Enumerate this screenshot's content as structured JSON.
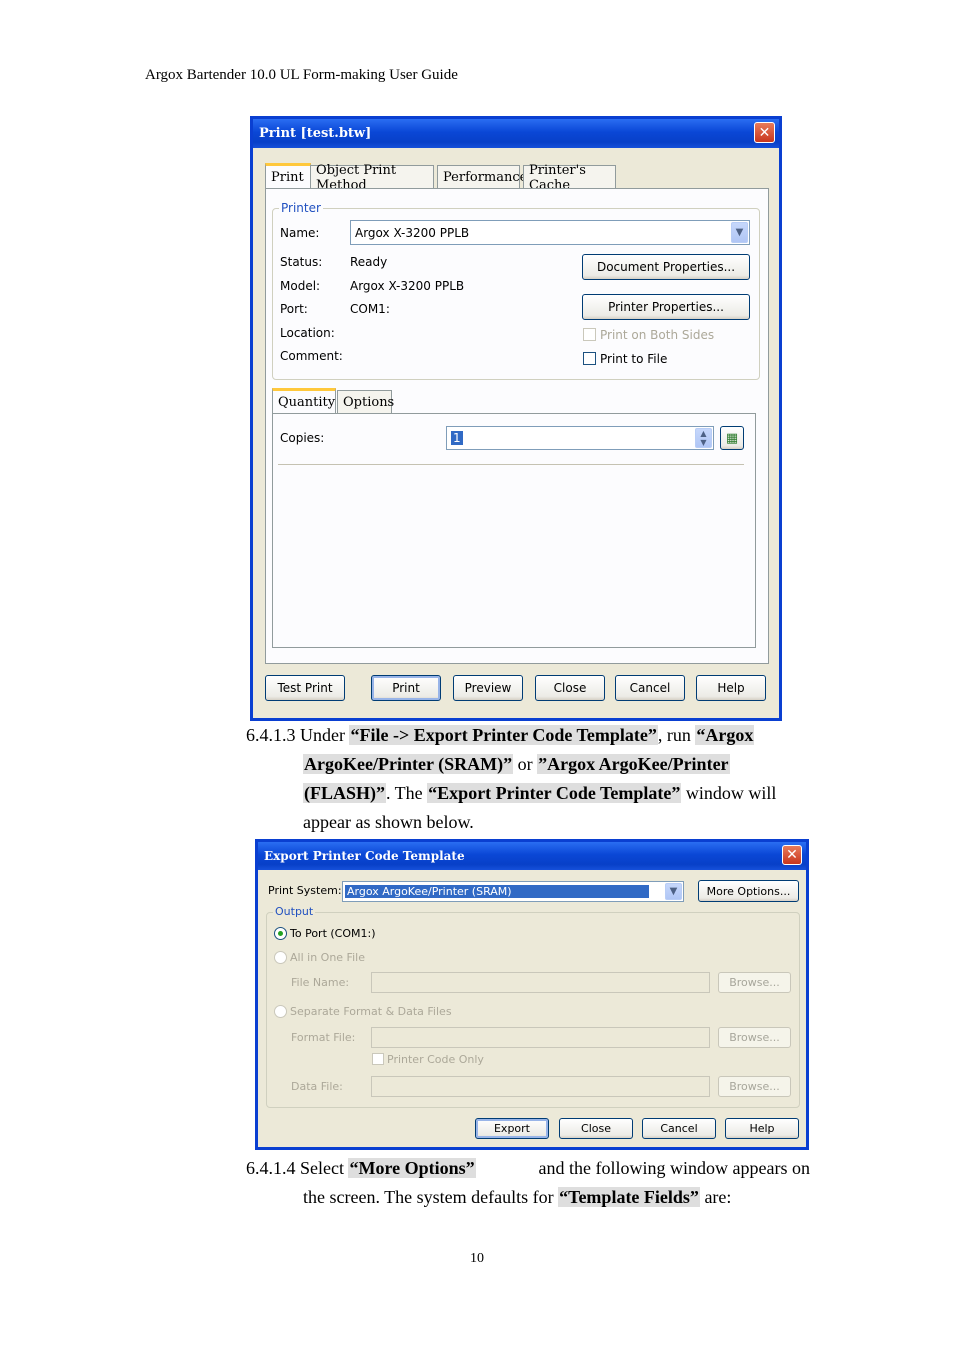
{
  "header": {
    "text": "Argox Bartender 10.0 UL Form-making User Guide"
  },
  "print_dialog": {
    "title": "Print [test.btw]",
    "tabs": [
      "Print",
      "Object Print Method",
      "Performance",
      "Printer's Cache"
    ],
    "printer_group": "Printer",
    "name_label": "Name:",
    "name_value": "Argox X-3200 PPLB",
    "status_label": "Status:",
    "status_value": "Ready",
    "model_label": "Model:",
    "model_value": "Argox X-3200 PPLB",
    "port_label": "Port:",
    "port_value": "COM1:",
    "location_label": "Location:",
    "comment_label": "Comment:",
    "doc_props": "Document Properties...",
    "printer_props": "Printer Properties...",
    "both_sides": "Print on Both Sides",
    "print_to_file": "Print to File",
    "sub_tabs": [
      "Quantity",
      "Options"
    ],
    "copies_label": "Copies:",
    "copies_value": "1",
    "buttons": [
      "Test Print",
      "Print",
      "Preview",
      "Close",
      "Cancel",
      "Help"
    ]
  },
  "para1": {
    "number": "6.4.1.3",
    "t1": "Under ",
    "b1": "“File -> Export Printer Code Template”",
    "t2": ", run ",
    "b2a": "“Argox",
    "b2b": "ArgoKee/Printer (SRAM)”",
    "t3": " or ",
    "b3a": "”Argox ArgoKee/Printer",
    "b3b": "(FLASH)”",
    "t4": ". The ",
    "b4": "“Export Printer Code Template”",
    "t5": " window will",
    "t6": "appear as shown below."
  },
  "export_dialog": {
    "title": "Export Printer Code Template",
    "print_system_label": "Print System:",
    "print_system_value": "Argox ArgoKee/Printer (SRAM)",
    "more_options": "More Options...",
    "output_group": "Output",
    "to_port": "To Port (COM1:)",
    "all_in_one": "All in One File",
    "file_name": "File Name:",
    "browse": "Browse...",
    "separate": "Separate Format & Data Files",
    "format_file": "Format File:",
    "printer_code_only": "Printer Code Only",
    "data_file": "Data File:",
    "buttons": [
      "Export",
      "Close",
      "Cancel",
      "Help"
    ]
  },
  "para2": {
    "number": "6.4.1.4",
    "t1": "Select ",
    "b1": "“More Options”",
    "t2": " and the following window appears on",
    "t3": "the screen. The system defaults for ",
    "b2": "“Template Fields”",
    "t4": " are:"
  },
  "page_number": "10"
}
